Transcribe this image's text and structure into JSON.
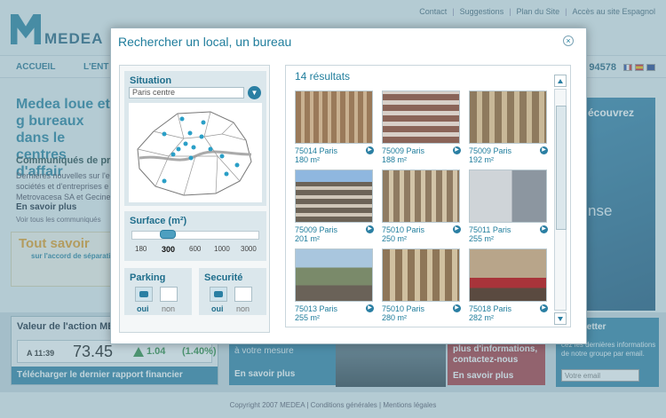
{
  "colors": {
    "accent": "#1f7d9c",
    "button": "#2a7fa3",
    "promo": "#e39a1e",
    "positive": "#2b8a3e",
    "red_block": "#a8323a"
  },
  "logo": {
    "text": "MEDEA"
  },
  "topnav": {
    "contact": "Contact",
    "suggestions": "Suggestions",
    "plan": "Plan du Site",
    "spanish": "Accès au site Espagnol",
    "sep": "|"
  },
  "mainnav": {
    "accueil": "ACCUEIL",
    "second": "L'ENT",
    "phone": "94578"
  },
  "background": {
    "headline": "Medea loue et g bureaux dans le centres d'affair",
    "news_title": "Communiqués de pr",
    "news_body": "Dernières nouvelles sur l'e sociétés et d'entreprises e Metrovacesa SA et Gecine",
    "more": "En savoir plus",
    "more_all": "Voir tous les communiqués",
    "promo_title": "Tout savoir",
    "promo_sub": "sur l'accord de séparati",
    "right_label": "écouvrez",
    "right_big": "nse"
  },
  "stock": {
    "title": "Valeur de l'action MEI",
    "time": "A 11:39",
    "price": "73.45",
    "change": "1.04",
    "percent": "(1.40%)",
    "download": "Télécharger le dernier rapport financier"
  },
  "band2": {
    "text": "à votre mesure",
    "more": "En savoir plus"
  },
  "red": {
    "text": "plus d'informations, contactez-nous",
    "more": "En savoir plus"
  },
  "newsletter": {
    "heading": "letter",
    "text": "cez les dernières informations de notre groupe par email.",
    "placeholder": "Votre email"
  },
  "footer": {
    "text": "Copyright 2007 MEDEA   |   Conditions générales   |   Mentions légales"
  },
  "modal": {
    "title": "Rechercher un local, un bureau",
    "close_symbol": "×",
    "situation": {
      "label": "Situation",
      "selected": "Paris centre"
    },
    "surface": {
      "label": "Surface (m²)",
      "ticks": [
        "180",
        "300",
        "600",
        "1000",
        "3000"
      ],
      "selected_tick": "300"
    },
    "parking": {
      "label": "Parking",
      "on": "oui",
      "off": "non"
    },
    "securite": {
      "label": "Securité",
      "on": "oui",
      "off": "non"
    },
    "results_count": "14 résultats",
    "results": [
      {
        "city": "75014 Paris",
        "area": "180 m²"
      },
      {
        "city": "75009 Paris",
        "area": "188 m²"
      },
      {
        "city": "75009 Paris",
        "area": "192 m²"
      },
      {
        "city": "75009 Paris",
        "area": "201 m²"
      },
      {
        "city": "75010 Paris",
        "area": "250 m²"
      },
      {
        "city": "75011 Paris",
        "area": "255 m²"
      },
      {
        "city": "75013 Paris",
        "area": "255 m²"
      },
      {
        "city": "75010 Paris",
        "area": "280 m²"
      },
      {
        "city": "75018 Paris",
        "area": "282 m²"
      }
    ]
  }
}
